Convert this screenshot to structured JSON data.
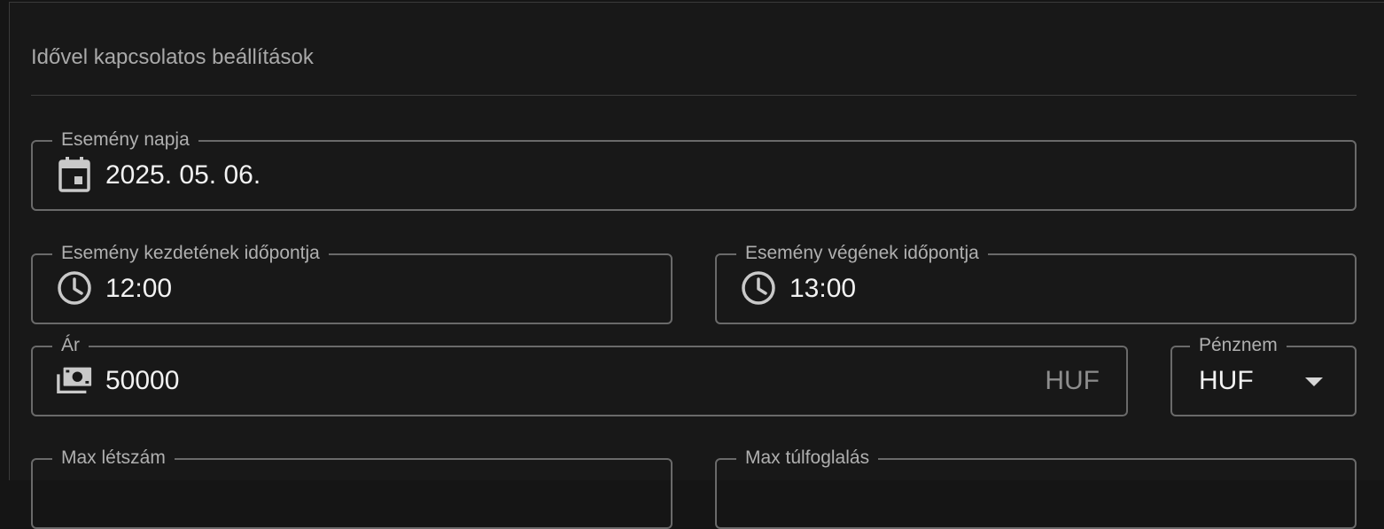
{
  "section": {
    "title": "Idővel kapcsolatos beállítások"
  },
  "fields": {
    "event_date": {
      "label": "Esemény napja",
      "value": "2025. 05. 06.",
      "icon": "calendar-icon"
    },
    "start_time": {
      "label": "Esemény kezdetének időpontja",
      "value": "12:00",
      "icon": "clock-icon"
    },
    "end_time": {
      "label": "Esemény végének időpontja",
      "value": "13:00",
      "icon": "clock-icon"
    },
    "price": {
      "label": "Ár",
      "value": "50000",
      "suffix": "HUF",
      "icon": "money-icon"
    },
    "currency": {
      "label": "Pénznem",
      "value": "HUF",
      "icon": "caret-down-icon"
    },
    "max_headcount": {
      "label": "Max létszám"
    },
    "max_overbooking": {
      "label": "Max túlfoglalás"
    }
  },
  "colors": {
    "background": "#181818",
    "border": "#6a6a6a",
    "text": "#f2f2f2",
    "label": "#b0b0b0"
  }
}
